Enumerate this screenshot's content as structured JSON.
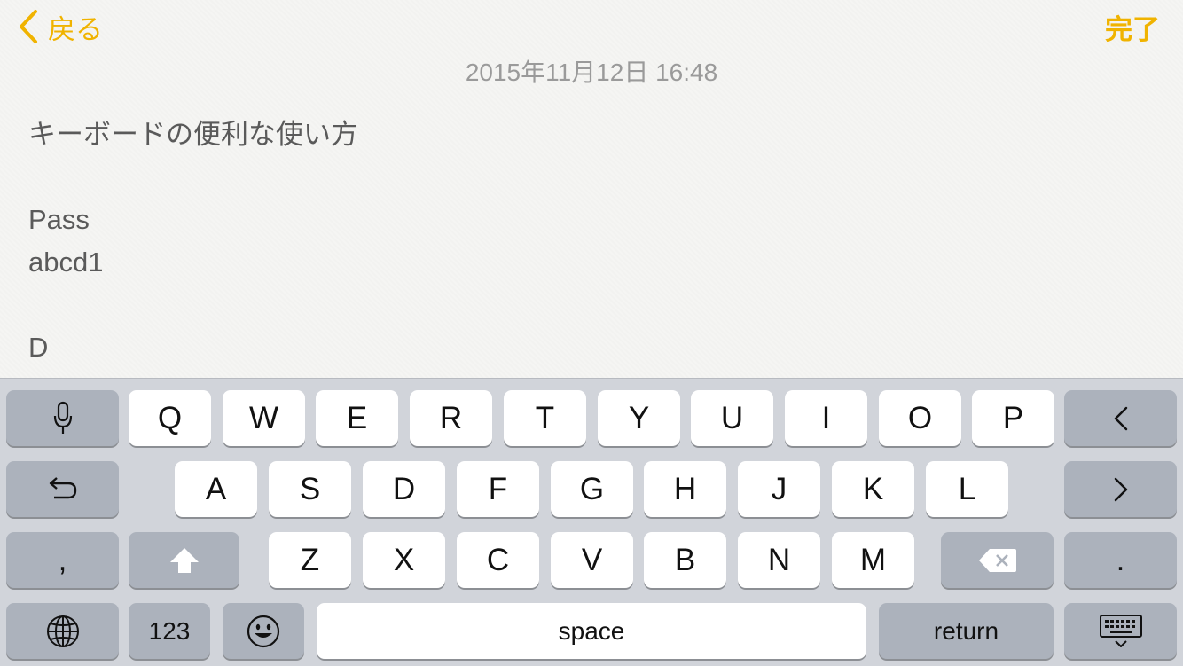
{
  "nav": {
    "back_label": "戻る",
    "done_label": "完了"
  },
  "note": {
    "date": "2015年11月12日 16:48",
    "lines": [
      "キーボードの便利な使い方",
      "",
      "Pass",
      "abcd1",
      "",
      "D"
    ]
  },
  "keyboard": {
    "row1": [
      "Q",
      "W",
      "E",
      "R",
      "T",
      "Y",
      "U",
      "I",
      "O",
      "P"
    ],
    "row2": [
      "A",
      "S",
      "D",
      "F",
      "G",
      "H",
      "J",
      "K",
      "L"
    ],
    "row3": [
      "Z",
      "X",
      "C",
      "V",
      "B",
      "N",
      "M"
    ],
    "comma": ",",
    "period": ".",
    "numbers": "123",
    "space": "space",
    "return": "return"
  },
  "colors": {
    "accent": "#f0b300",
    "keyboard_bg": "#d1d4da",
    "key_dark": "#acb2bc"
  }
}
